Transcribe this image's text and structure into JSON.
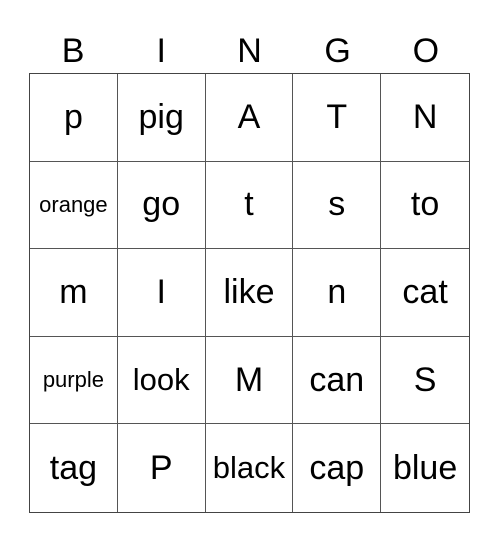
{
  "header": [
    "B",
    "I",
    "N",
    "G",
    "O"
  ],
  "cells": [
    [
      "p",
      "pig",
      "A",
      "T",
      "N"
    ],
    [
      "orange",
      "go",
      "t",
      "s",
      "to"
    ],
    [
      "m",
      "I",
      "like",
      "n",
      "cat"
    ],
    [
      "purple",
      "look",
      "M",
      "can",
      "S"
    ],
    [
      "tag",
      "P",
      "black",
      "cap",
      "blue"
    ]
  ]
}
